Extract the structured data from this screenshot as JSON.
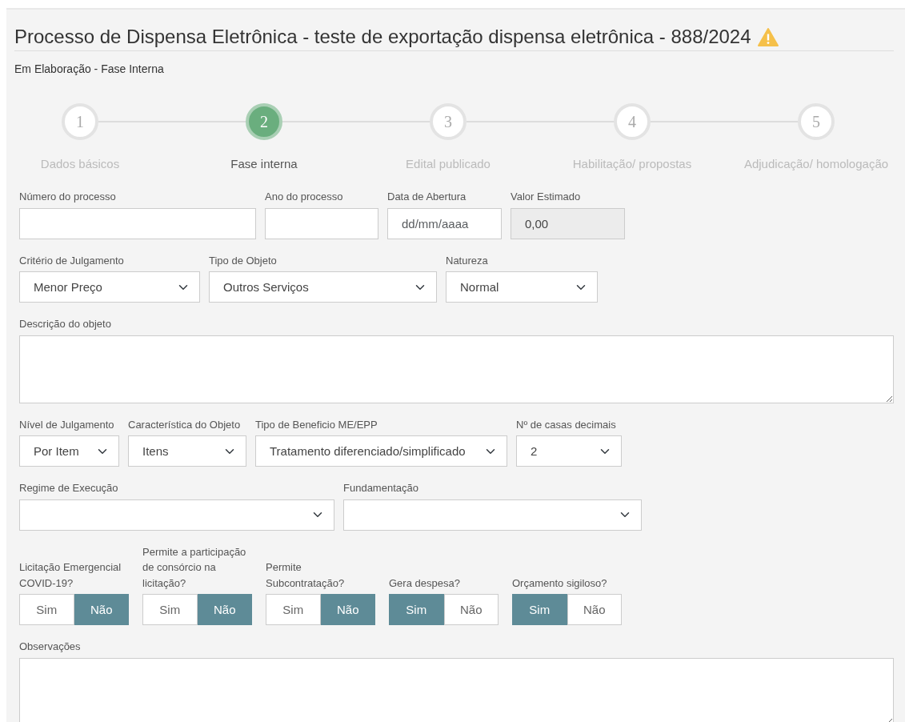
{
  "title": "Processo de Dispensa Eletrônica - teste de exportação dispensa eletrônica - 888/2024",
  "warning": true,
  "status": "Em Elaboração - Fase Interna",
  "steps": [
    {
      "number": "1",
      "label": "Dados básicos",
      "selected": false
    },
    {
      "number": "2",
      "label": "Fase interna",
      "selected": true
    },
    {
      "number": "3",
      "label": "Edital publicado",
      "selected": false
    },
    {
      "number": "4",
      "label": "Habilitação/ propostas",
      "selected": false
    },
    {
      "number": "5",
      "label": "Adjudicação/ homologação",
      "selected": false
    }
  ],
  "form_rows": [
    [
      {
        "kind": "text",
        "label": "Número do processo"
      },
      {
        "kind": "text",
        "label": "Ano do processo"
      },
      {
        "kind": "text",
        "label": "Data de Abertura",
        "placeholder": "dd/mm/aaaa"
      },
      {
        "kind": "text",
        "label": "Valor Estimado",
        "value": "0,00",
        "disabled": true
      }
    ],
    [
      {
        "kind": "select",
        "label": "Critério de Julgamento",
        "value": "Menor Preço"
      },
      {
        "kind": "select",
        "label": "Tipo de Objeto",
        "value": "Outros Serviços"
      },
      {
        "kind": "select",
        "label": "Natureza",
        "value": "Normal"
      }
    ],
    [
      {
        "kind": "textarea",
        "label": "Descrição do objeto"
      }
    ],
    [
      {
        "kind": "select",
        "label": "Nível de Julgamento",
        "value": "Por Item"
      },
      {
        "kind": "select",
        "label": "Característica do Objeto",
        "value": "Itens"
      },
      {
        "kind": "select",
        "label": "Tipo de Beneficio ME/EPP",
        "value": "Tratamento diferenciado/simplificado"
      },
      {
        "kind": "select",
        "label": "Nº de casas decimais",
        "value": "2"
      }
    ],
    [
      {
        "kind": "select",
        "label": "Regime de Execução"
      },
      {
        "kind": "select",
        "label": "Fundamentação"
      }
    ],
    [
      {
        "kind": "toggle",
        "label": "Licitação Emergencial COVID-19?",
        "options": [
          {
            "label": "Sim",
            "selected": false
          },
          {
            "label": "Não",
            "selected": true
          }
        ]
      },
      {
        "kind": "toggle",
        "label": "Permite a participação de consórcio na licitação?",
        "options": [
          {
            "label": "Sim",
            "selected": false
          },
          {
            "label": "Não",
            "selected": true
          }
        ]
      },
      {
        "kind": "toggle",
        "label": "Permite Subcontratação?",
        "options": [
          {
            "label": "Sim",
            "selected": false
          },
          {
            "label": "Não",
            "selected": true
          }
        ]
      },
      {
        "kind": "toggle",
        "label": "Gera despesa?",
        "options": [
          {
            "label": "Sim",
            "selected": true
          },
          {
            "label": "Não",
            "selected": false
          }
        ]
      },
      {
        "kind": "toggle",
        "label": "Orçamento sigiloso?",
        "options": [
          {
            "label": "Sim",
            "selected": true
          },
          {
            "label": "Não",
            "selected": false
          }
        ]
      }
    ],
    [
      {
        "kind": "textarea",
        "label": "Observações"
      }
    ]
  ]
}
